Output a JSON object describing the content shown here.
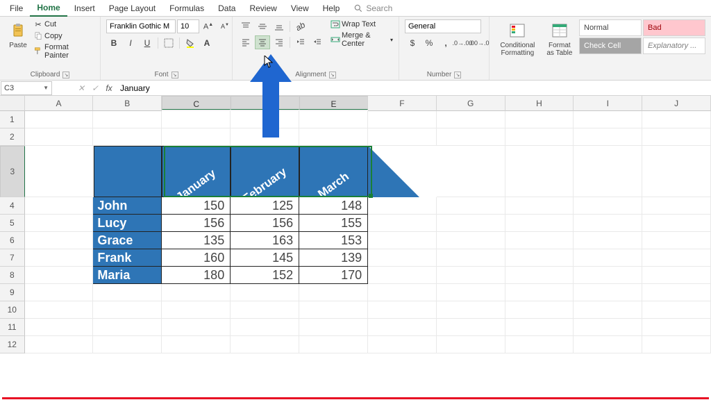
{
  "tabs": [
    "File",
    "Home",
    "Insert",
    "Page Layout",
    "Formulas",
    "Data",
    "Review",
    "View",
    "Help"
  ],
  "active_tab": "Home",
  "search": {
    "placeholder": "Search"
  },
  "ribbon": {
    "clipboard": {
      "paste": "Paste",
      "cut": "Cut",
      "copy": "Copy",
      "painter": "Format Painter",
      "title": "Clipboard"
    },
    "font": {
      "name": "Franklin Gothic M",
      "size": "10",
      "bold": "B",
      "italic": "I",
      "underline": "U",
      "title": "Font"
    },
    "alignment": {
      "wrap": "Wrap Text",
      "merge": "Merge & Center",
      "title": "Alignment"
    },
    "number": {
      "format": "General",
      "title": "Number"
    },
    "styles": {
      "cond": "Conditional Formatting",
      "table": "Format as Table",
      "normal": "Normal",
      "bad": "Bad",
      "check": "Check Cell",
      "expl": "Explanatory ..."
    }
  },
  "namebox": "C3",
  "formula": "January",
  "columns": [
    "A",
    "B",
    "C",
    "D",
    "E",
    "F",
    "G",
    "H",
    "I",
    "J"
  ],
  "selected_cols": [
    "C",
    "D",
    "E"
  ],
  "row_heights": {
    "default": 25,
    "r3": 74
  },
  "selected_row": 3,
  "chart_data": {
    "type": "table",
    "categories": [
      "January",
      "February",
      "March"
    ],
    "series": [
      {
        "name": "John",
        "values": [
          150,
          125,
          148
        ]
      },
      {
        "name": "Lucy",
        "values": [
          156,
          156,
          155
        ]
      },
      {
        "name": "Grace",
        "values": [
          135,
          163,
          153
        ]
      },
      {
        "name": "Frank",
        "values": [
          160,
          145,
          139
        ]
      },
      {
        "name": "Maria",
        "values": [
          180,
          152,
          170
        ]
      }
    ]
  },
  "accent": "#2e75b6"
}
